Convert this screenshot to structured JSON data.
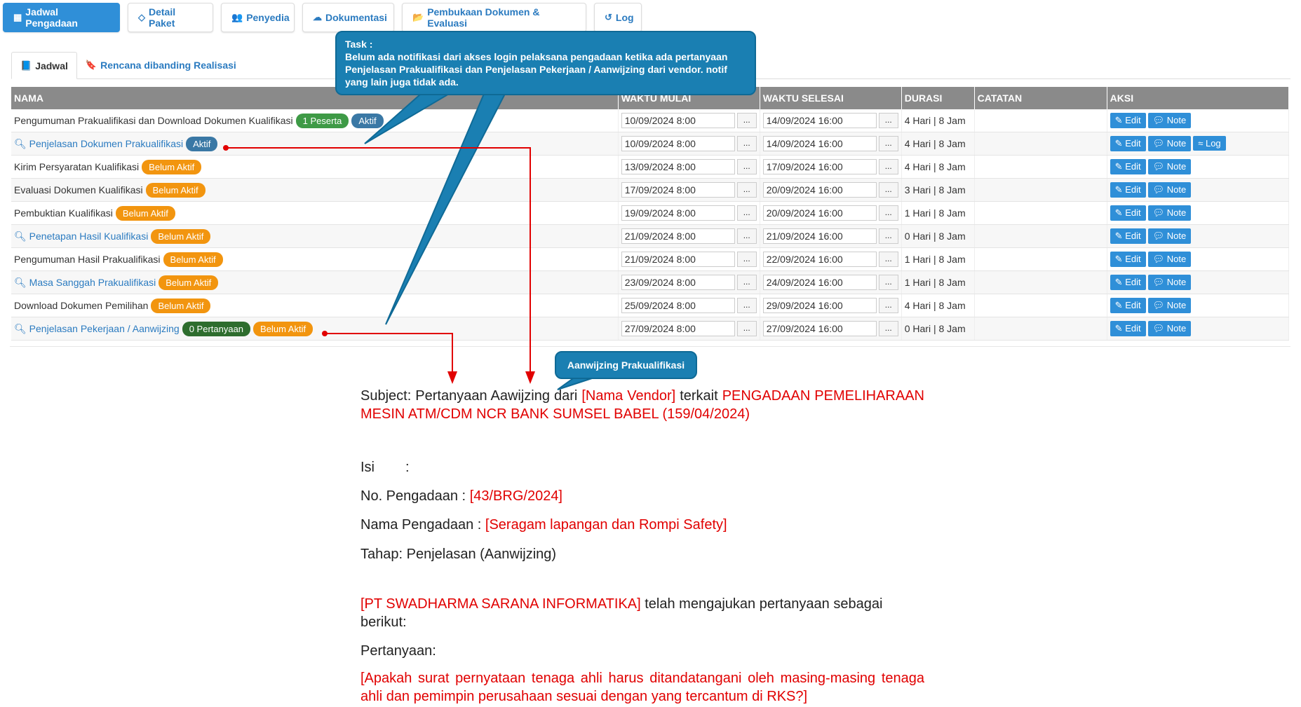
{
  "top_tabs": [
    {
      "label": "Jadwal Pengadaan",
      "icon": "calendar-icon",
      "glyph": "▦"
    },
    {
      "label": "Detail Paket",
      "icon": "diamond-icon",
      "glyph": "◇"
    },
    {
      "label": "Penyedia",
      "icon": "users-icon",
      "glyph": "👥"
    },
    {
      "label": "Dokumentasi",
      "icon": "cloud-icon",
      "glyph": "☁"
    },
    {
      "label": "Pembukaan Dokumen & Evaluasi",
      "icon": "folder-open-icon",
      "glyph": "📂"
    },
    {
      "label": "Log",
      "icon": "history-icon",
      "glyph": "↺"
    }
  ],
  "sub_tabs": [
    {
      "label": "Jadwal",
      "icon": "book-icon",
      "glyph": "📘"
    },
    {
      "label": "Rencana dibanding Realisasi",
      "icon": "bookmark-icon",
      "glyph": "🔖"
    }
  ],
  "table": {
    "headers": [
      "NAMA",
      "WAKTU MULAI",
      "WAKTU SELESAI",
      "DURASI",
      "CATATAN",
      "AKSI"
    ],
    "rows": [
      {
        "name": "Pengumuman Prakualifikasi dan Download Dokumen Kualifikasi",
        "link": false,
        "badges": [
          {
            "text": "1 Peserta",
            "color": "green"
          },
          {
            "text": "Aktif",
            "color": "blue"
          }
        ],
        "start": "10/09/2024 8:00",
        "end": "14/09/2024 16:00",
        "duration": "4 Hari | 8 Jam",
        "log": false
      },
      {
        "name": "Penjelasan Dokumen Prakualifikasi",
        "link": true,
        "badges": [
          {
            "text": "Aktif",
            "color": "blue"
          }
        ],
        "start": "10/09/2024 8:00",
        "end": "14/09/2024 16:00",
        "duration": "4 Hari | 8 Jam",
        "log": true
      },
      {
        "name": "Kirim Persyaratan Kualifikasi",
        "link": false,
        "badges": [
          {
            "text": "Belum Aktif",
            "color": "orange"
          }
        ],
        "start": "13/09/2024 8:00",
        "end": "17/09/2024 16:00",
        "duration": "4 Hari | 8 Jam",
        "log": false
      },
      {
        "name": "Evaluasi Dokumen Kualifikasi",
        "link": false,
        "badges": [
          {
            "text": "Belum Aktif",
            "color": "orange"
          }
        ],
        "start": "17/09/2024 8:00",
        "end": "20/09/2024 16:00",
        "duration": "3 Hari | 8 Jam",
        "log": false
      },
      {
        "name": "Pembuktian Kualifikasi",
        "link": false,
        "badges": [
          {
            "text": "Belum Aktif",
            "color": "orange"
          }
        ],
        "start": "19/09/2024 8:00",
        "end": "20/09/2024 16:00",
        "duration": "1 Hari | 8 Jam",
        "log": false
      },
      {
        "name": "Penetapan Hasil Kualifikasi",
        "link": true,
        "badges": [
          {
            "text": "Belum Aktif",
            "color": "orange"
          }
        ],
        "start": "21/09/2024 8:00",
        "end": "21/09/2024 16:00",
        "duration": "0 Hari | 8 Jam",
        "log": false
      },
      {
        "name": "Pengumuman Hasil Prakualifikasi",
        "link": false,
        "badges": [
          {
            "text": "Belum Aktif",
            "color": "orange"
          }
        ],
        "start": "21/09/2024 8:00",
        "end": "22/09/2024 16:00",
        "duration": "1 Hari | 8 Jam",
        "log": false
      },
      {
        "name": "Masa Sanggah Prakualifikasi",
        "link": true,
        "badges": [
          {
            "text": "Belum Aktif",
            "color": "orange"
          }
        ],
        "start": "23/09/2024 8:00",
        "end": "24/09/2024 16:00",
        "duration": "1 Hari | 8 Jam",
        "log": false
      },
      {
        "name": "Download Dokumen Pemilihan",
        "link": false,
        "badges": [
          {
            "text": "Belum Aktif",
            "color": "orange"
          }
        ],
        "start": "25/09/2024 8:00",
        "end": "29/09/2024 16:00",
        "duration": "4 Hari | 8 Jam",
        "log": false
      },
      {
        "name": "Penjelasan Pekerjaan / Aanwijzing",
        "link": true,
        "badges": [
          {
            "text": "0 Pertanyaan",
            "color": "dark"
          },
          {
            "text": "Belum Aktif",
            "color": "orange"
          }
        ],
        "start": "27/09/2024 8:00",
        "end": "27/09/2024 16:00",
        "duration": "0 Hari | 8 Jam",
        "log": false
      }
    ],
    "picker_label": "...",
    "edit_label": "Edit",
    "note_label": "Note",
    "log_label": "Log"
  },
  "callout_task": {
    "title": "Task :",
    "body": "Belum ada notifikasi dari akses login pelaksana pengadaan ketika ada pertanyaan Penjelasan Prakualifikasi dan Penjelasan Pekerjaan / Aanwijzing dari vendor. notif yang lain juga tidak ada."
  },
  "callout_small": "Aanwijzing Prakualifikasi",
  "email": {
    "subject_prefix": "Subject: Pertanyaan Aawijzing dari ",
    "vendor_placeholder": "[Nama Vendor]",
    "subject_mid": " terkait ",
    "subject_project": "PENGADAAN PEMELIHARAAN MESIN ATM/CDM NCR BANK SUMSEL BABEL (159/04/2024)",
    "isi_label": "Isi",
    "isi_colon": ":",
    "no_label": "No. Pengadaan : ",
    "no_value": "[43/BRG/2024]",
    "nama_label": "Nama Pengadaan : ",
    "nama_value": "[Seragam lapangan dan Rompi Safety]",
    "tahap": "Tahap: Penjelasan (Aanwijzing)",
    "company": "[PT SWADHARMA SARANA INFORMATIKA]",
    "company_suffix": " telah mengajukan pertanyaan sebagai berikut:",
    "question_label": "Pertanyaan:",
    "question": "[Apakah surat pernyataan tenaga ahli harus ditandatangani oleh masing-masing tenaga ahli dan pemimpin perusahaan sesuai dengan yang tercantum di RKS?]"
  },
  "colors": {
    "accent": "#2f8fd8",
    "callout": "#1a7fb2",
    "highlight": "#e10000"
  }
}
